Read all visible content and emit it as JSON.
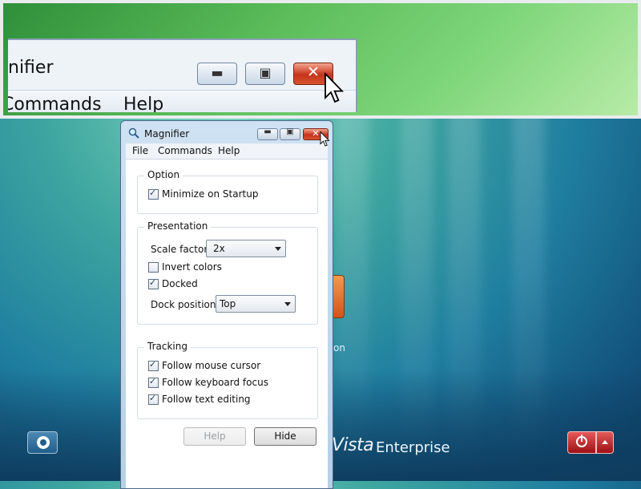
{
  "colors": {
    "accent": "#c6331c",
    "window_frame": "#b6cfe7",
    "dock_background": "#5cbd5a"
  },
  "magnified_view": {
    "title": "nifier",
    "menu": [
      "Commands",
      "Help"
    ],
    "buttons": [
      "minimize-icon",
      "maximize-icon",
      "close-icon"
    ]
  },
  "window": {
    "title": "Magnifier",
    "icon": "magnifier-icon",
    "menu": [
      "File",
      "Commands",
      "Help"
    ]
  },
  "option_group": {
    "label": "Option",
    "items": [
      {
        "label": "Minimize on Startup",
        "checked": true
      }
    ]
  },
  "presentation_group": {
    "label": "Presentation",
    "scale_factor_label": "Scale factor:",
    "scale_factor_value": "2x",
    "invert_colors": {
      "label": "Invert colors",
      "checked": false
    },
    "docked": {
      "label": "Docked",
      "checked": true
    },
    "dock_position_label": "Dock position:",
    "dock_position_value": "Top"
  },
  "tracking_group": {
    "label": "Tracking",
    "items": [
      {
        "label": "Follow mouse cursor",
        "checked": true
      },
      {
        "label": "Follow keyboard focus",
        "checked": true
      },
      {
        "label": "Follow text editing",
        "checked": true
      }
    ]
  },
  "buttons": {
    "help": "Help",
    "hide": "Hide"
  },
  "desktop": {
    "partial_label": "on",
    "brand_word": "Vista",
    "edition": "Enterprise",
    "ease_of_access_icon": "ease-of-access-icon",
    "power_icon": "power-icon"
  }
}
